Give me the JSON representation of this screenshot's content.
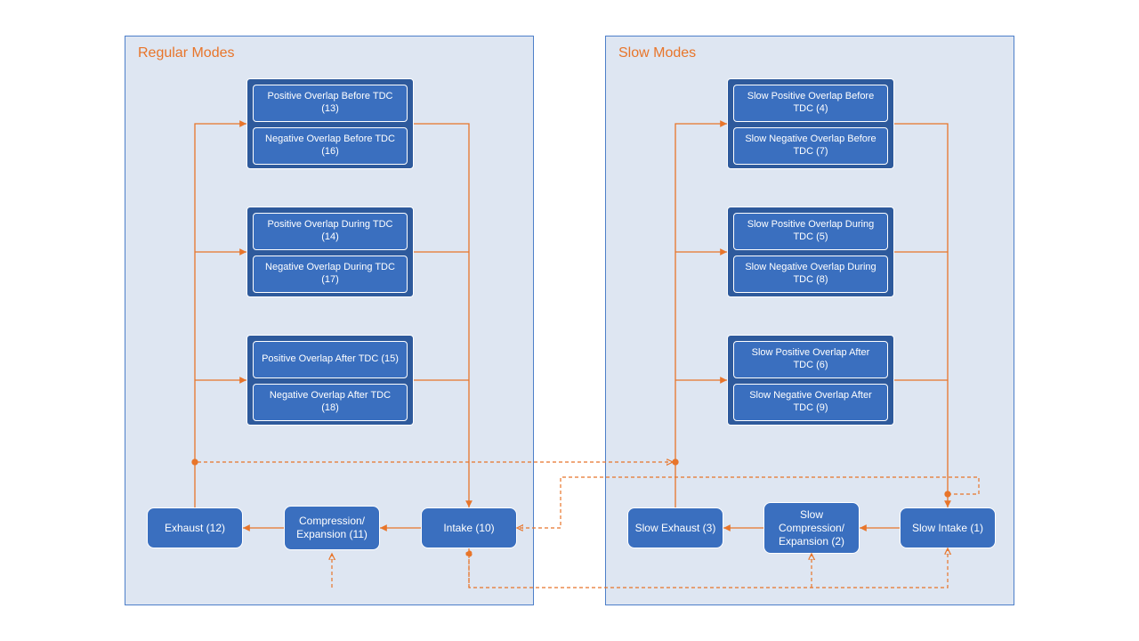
{
  "diagram": {
    "panels": {
      "regular": {
        "title": "Regular Modes",
        "blocks": {
          "before": {
            "pos": "Positive Overlap Before TDC (13)",
            "neg": "Negative Overlap Before TDC (16)"
          },
          "during": {
            "pos": "Positive Overlap During TDC (14)",
            "neg": "Negative Overlap During TDC (17)"
          },
          "after": {
            "pos": "Positive Overlap After TDC (15)",
            "neg": "Negative Overlap After TDC (18)"
          }
        },
        "nodes": {
          "exhaust": "Exhaust (12)",
          "compexp": "Compression/ Expansion (11)",
          "intake": "Intake (10)"
        }
      },
      "slow": {
        "title": "Slow Modes",
        "blocks": {
          "before": {
            "pos": "Slow Positive Overlap Before TDC (4)",
            "neg": "Slow Negative Overlap Before TDC (7)"
          },
          "during": {
            "pos": "Slow Positive Overlap During TDC (5)",
            "neg": "Slow Negative Overlap During TDC (8)"
          },
          "after": {
            "pos": "Slow Positive Overlap After TDC (6)",
            "neg": "Slow Negative Overlap After TDC (9)"
          }
        },
        "nodes": {
          "exhaust": "Slow Exhaust (3)",
          "compexp": "Slow Compression/ Expansion (2)",
          "intake": "Slow Intake (1)"
        }
      }
    }
  }
}
